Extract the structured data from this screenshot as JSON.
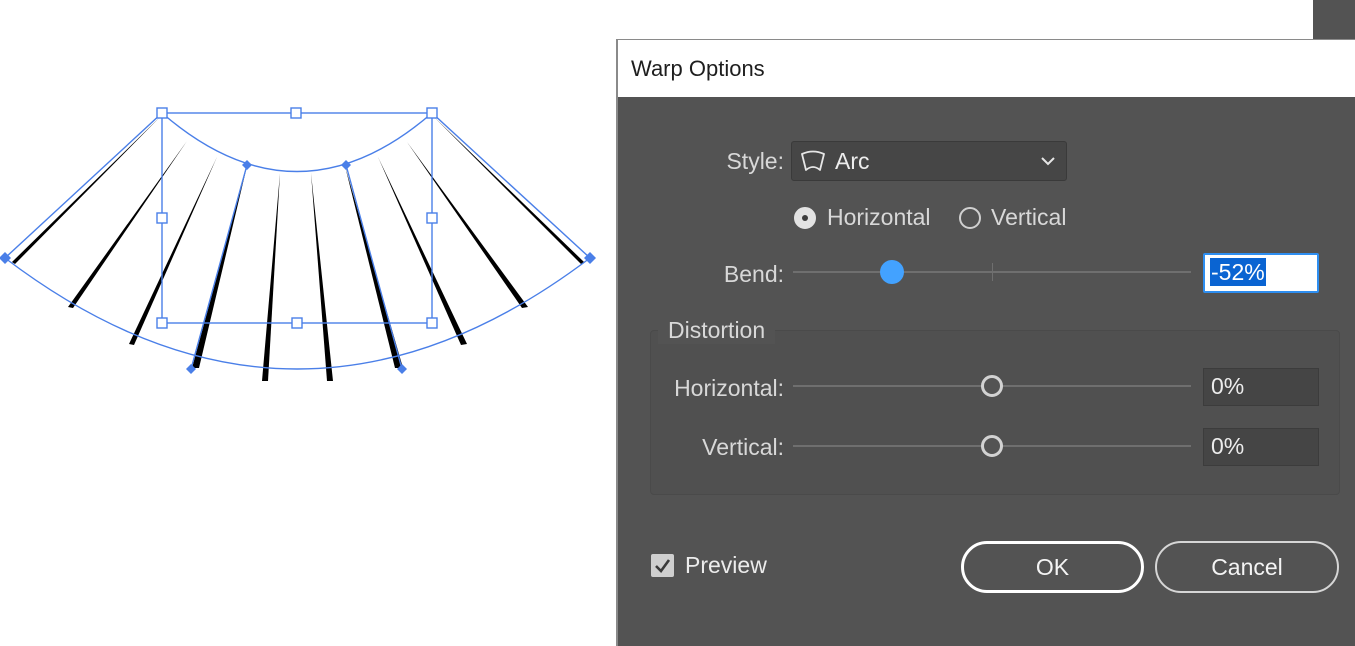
{
  "dialog": {
    "title": "Warp Options",
    "style": {
      "label": "Style:",
      "value": "Arc",
      "icon": "arc-warp-icon"
    },
    "orientation": {
      "options": [
        "Horizontal",
        "Vertical"
      ],
      "selected": "Horizontal"
    },
    "bend": {
      "label": "Bend:",
      "value": "-52%",
      "percent": -52
    },
    "distortion": {
      "title": "Distortion",
      "horizontal": {
        "label": "Horizontal:",
        "value": "0%",
        "percent": 0
      },
      "vertical": {
        "label": "Vertical:",
        "value": "0%",
        "percent": 0
      }
    },
    "preview": {
      "label": "Preview",
      "checked": true
    },
    "buttons": {
      "ok": "OK",
      "cancel": "Cancel"
    }
  },
  "colors": {
    "dialog_bg": "#535353",
    "selection": "#4a7fe8",
    "slider_active": "#43a2ff",
    "text_highlight": "#0a64d2"
  }
}
